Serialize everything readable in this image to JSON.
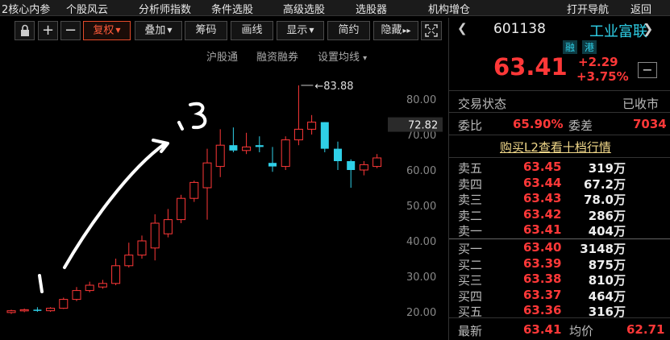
{
  "top_menu": [
    "2核心内参",
    "个股风云",
    "分析师指数",
    "条件选股",
    "高级选股",
    "选股器",
    "机构增仓",
    "打开导航",
    "返回"
  ],
  "toolbar": {
    "lock_icon": "lock-icon",
    "plus": "+",
    "minus": "−",
    "fuquan": "复权",
    "diejia": "叠加",
    "chouma": "筹码",
    "huaxian": "画线",
    "xianshi": "显示",
    "jianyue": "简约",
    "yincang": "隐藏",
    "yincang_arrows": "▸▸",
    "expand_icon": "expand-icon"
  },
  "sublinks": {
    "hugutong": "沪股通",
    "rongzi": "融资融券",
    "shezhi": "设置均线",
    "shezhi_caret": "▾"
  },
  "stock": {
    "code": "601138",
    "name": "工业富联",
    "rong": "融",
    "gang": "港",
    "price": "63.41",
    "change": "+2.29",
    "change_pct": "+3.75%",
    "minus_btn": "−"
  },
  "status": {
    "label": "交易状态",
    "value": "已收市",
    "weibi_label": "委比",
    "weibi_value": "65.90%",
    "weicha_label": "委差",
    "weicha_value": "7034"
  },
  "l2_link": "购买L2查看十档行情",
  "order_book": {
    "sell": [
      {
        "label": "卖五",
        "price": "63.45",
        "vol": "319万"
      },
      {
        "label": "卖四",
        "price": "63.44",
        "vol": "67.2万"
      },
      {
        "label": "卖三",
        "price": "63.43",
        "vol": "78.0万"
      },
      {
        "label": "卖二",
        "price": "63.42",
        "vol": "286万"
      },
      {
        "label": "卖一",
        "price": "63.41",
        "vol": "404万"
      }
    ],
    "buy": [
      {
        "label": "买一",
        "price": "63.40",
        "vol": "3148万"
      },
      {
        "label": "买二",
        "price": "63.39",
        "vol": "875万"
      },
      {
        "label": "买三",
        "price": "63.38",
        "vol": "810万"
      },
      {
        "label": "买四",
        "price": "63.37",
        "vol": "464万"
      },
      {
        "label": "买五",
        "price": "63.36",
        "vol": "316万"
      }
    ]
  },
  "bottom": {
    "latest_label": "最新",
    "latest_value": "63.41",
    "avg_label": "均价",
    "avg_value": "62.71"
  },
  "colors": {
    "up": "#ff3838",
    "down": "#2fd0e8",
    "text": "#dddddd",
    "bg": "#000000"
  },
  "chart_data": {
    "type": "candlestick",
    "y_ticks": [
      "20.00",
      "30.00",
      "40.00",
      "50.00",
      "60.00",
      "70.00",
      "80.00"
    ],
    "ylim": [
      16,
      92
    ],
    "current_price_label": "72.82",
    "high_annotation": "83.88",
    "handwritten": [
      "1",
      "3"
    ],
    "candles": [
      {
        "o": 19.8,
        "h": 20.6,
        "l": 19.4,
        "c": 20.3
      },
      {
        "o": 20.3,
        "h": 20.9,
        "l": 19.9,
        "c": 20.6
      },
      {
        "o": 20.6,
        "h": 21.3,
        "l": 20.0,
        "c": 20.3
      },
      {
        "o": 20.3,
        "h": 21.3,
        "l": 20.0,
        "c": 21.0
      },
      {
        "o": 21.0,
        "h": 24.0,
        "l": 20.8,
        "c": 23.5
      },
      {
        "o": 23.5,
        "h": 27.0,
        "l": 23.0,
        "c": 26.0
      },
      {
        "o": 26.0,
        "h": 28.5,
        "l": 25.5,
        "c": 27.5
      },
      {
        "o": 27.0,
        "h": 29.0,
        "l": 26.5,
        "c": 28.0
      },
      {
        "o": 28.0,
        "h": 35.0,
        "l": 27.5,
        "c": 33.0
      },
      {
        "o": 33.0,
        "h": 39.5,
        "l": 32.5,
        "c": 36.0
      },
      {
        "o": 36.0,
        "h": 41.5,
        "l": 35.0,
        "c": 40.0
      },
      {
        "o": 38.0,
        "h": 47.5,
        "l": 34.5,
        "c": 45.0
      },
      {
        "o": 42.0,
        "h": 49.0,
        "l": 41.0,
        "c": 46.0
      },
      {
        "o": 46.0,
        "h": 53.0,
        "l": 45.0,
        "c": 52.0
      },
      {
        "o": 52.0,
        "h": 57.0,
        "l": 51.0,
        "c": 56.5
      },
      {
        "o": 55.0,
        "h": 66.0,
        "l": 46.0,
        "c": 62.0
      },
      {
        "o": 61.0,
        "h": 71.5,
        "l": 58.0,
        "c": 67.0
      },
      {
        "o": 67.0,
        "h": 72.0,
        "l": 65.0,
        "c": 65.5
      },
      {
        "o": 65.5,
        "h": 70.5,
        "l": 64.5,
        "c": 66.5
      },
      {
        "o": 67.0,
        "h": 69.5,
        "l": 65.0,
        "c": 66.5
      },
      {
        "o": 62.0,
        "h": 66.5,
        "l": 59.5,
        "c": 61.0
      },
      {
        "o": 61.0,
        "h": 69.5,
        "l": 60.0,
        "c": 68.5
      },
      {
        "o": 68.5,
        "h": 83.88,
        "l": 67.0,
        "c": 71.5
      },
      {
        "o": 71.5,
        "h": 75.5,
        "l": 70.0,
        "c": 73.5
      },
      {
        "o": 73.5,
        "h": 73.5,
        "l": 65.0,
        "c": 66.0
      },
      {
        "o": 66.0,
        "h": 68.0,
        "l": 60.0,
        "c": 62.5
      },
      {
        "o": 62.5,
        "h": 63.0,
        "l": 55.0,
        "c": 60.0
      },
      {
        "o": 60.0,
        "h": 62.5,
        "l": 58.5,
        "c": 61.5
      },
      {
        "o": 61.0,
        "h": 64.5,
        "l": 60.5,
        "c": 63.41
      }
    ]
  }
}
